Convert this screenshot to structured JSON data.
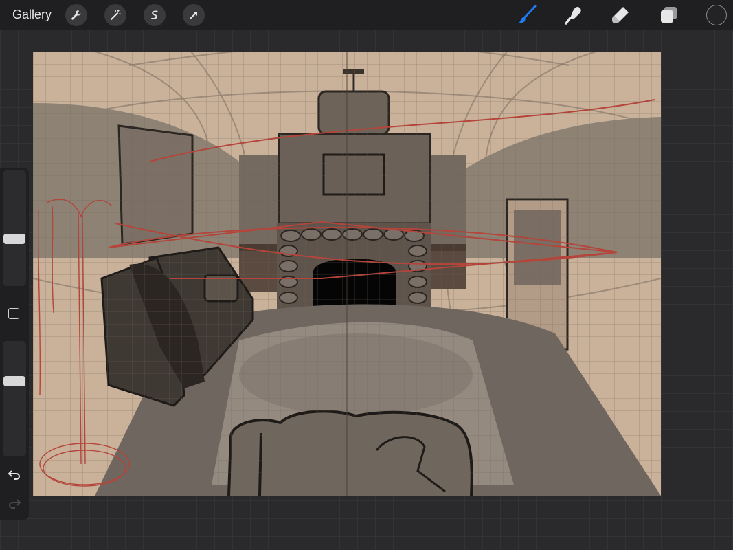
{
  "toolbar": {
    "gallery_label": "Gallery",
    "left_tools": [
      "wrench-icon",
      "magic-wand-icon",
      "selection-icon",
      "transform-arrow-icon"
    ],
    "right_tools": [
      "brush-icon",
      "smudge-icon",
      "eraser-icon",
      "layers-icon"
    ],
    "active_tool": "brush",
    "active_color": "#232325",
    "accent_color": "#1e7cf2"
  },
  "sidebar": {
    "brush_size_level": 0.42,
    "opacity_level": 0.36,
    "controls": [
      "undo-icon",
      "redo-icon",
      "modify-square-icon"
    ]
  },
  "canvas": {
    "paper_color": "#c9b19a",
    "grid": true,
    "guide_color": "#b5443a"
  }
}
